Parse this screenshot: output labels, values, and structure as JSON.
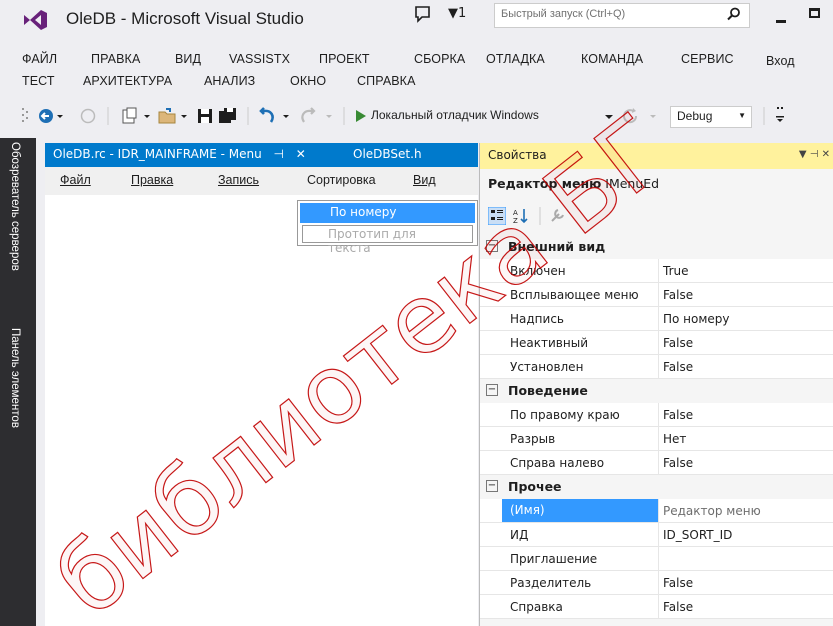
{
  "window": {
    "title": "OleDB - Microsoft Visual Studio",
    "notification_count": "1",
    "quick_launch_placeholder": "Быстрый запуск (Ctrl+Q)"
  },
  "menu": {
    "row1": [
      "ФАЙЛ",
      "ПРАВКА",
      "ВИД",
      "VASSISTX",
      "ПРОЕКТ",
      "СБОРКА",
      "ОТЛАДКА",
      "КОМАНДА",
      "СЕРВИС",
      "Вход"
    ],
    "row2": [
      "ТЕСТ",
      "АРХИТЕКТУРА",
      "АНАЛИЗ",
      "ОКНО",
      "СПРАВКА"
    ]
  },
  "toolbar": {
    "run_label": "Локальный отладчик Windows",
    "config": "Debug"
  },
  "sidebar": {
    "tabs": [
      "Обозреватель серверов",
      "Панель элементов"
    ]
  },
  "editor": {
    "active_tab": "OleDB.rc - IDR_MAINFRAME - Menu",
    "pin_glyph": "⊣",
    "close_glyph": "✕",
    "second_tab": "OleDBSet.h",
    "menu_items": [
      "Файл",
      "Правка",
      "Запись",
      "Сортировка",
      "Вид"
    ],
    "dropdown_selected": "По номеру",
    "dropdown_prototype": "Прототип для текста"
  },
  "properties": {
    "title": "Свойства",
    "object_name": "Редактор меню",
    "object_type": "IMenuEd",
    "categories": [
      {
        "name": "Внешний вид",
        "rows": [
          {
            "name": "Включен",
            "value": "True"
          },
          {
            "name": "Всплывающее меню",
            "value": "False"
          },
          {
            "name": "Надпись",
            "value": "По номеру"
          },
          {
            "name": "Неактивный",
            "value": "False"
          },
          {
            "name": "Установлен",
            "value": "False"
          }
        ]
      },
      {
        "name": "Поведение",
        "rows": [
          {
            "name": "По правому краю",
            "value": "False"
          },
          {
            "name": "Разрыв",
            "value": "Нет"
          },
          {
            "name": "Справа налево",
            "value": "False"
          }
        ]
      },
      {
        "name": "Прочее",
        "rows": [
          {
            "name": "(Имя)",
            "value": "Редактор меню",
            "selected": true
          },
          {
            "name": "ИД",
            "value": "ID_SORT_ID"
          },
          {
            "name": "Приглашение",
            "value": ""
          },
          {
            "name": "Разделитель",
            "value": "False"
          },
          {
            "name": "Справка",
            "value": "False"
          }
        ]
      }
    ],
    "collapse_glyph": "⊟"
  },
  "colors": {
    "accent": "#007acc",
    "selection": "#3399ff",
    "properties_header": "#fff29d",
    "sidebar": "#2d2d30",
    "watermark": "#c00000"
  }
}
